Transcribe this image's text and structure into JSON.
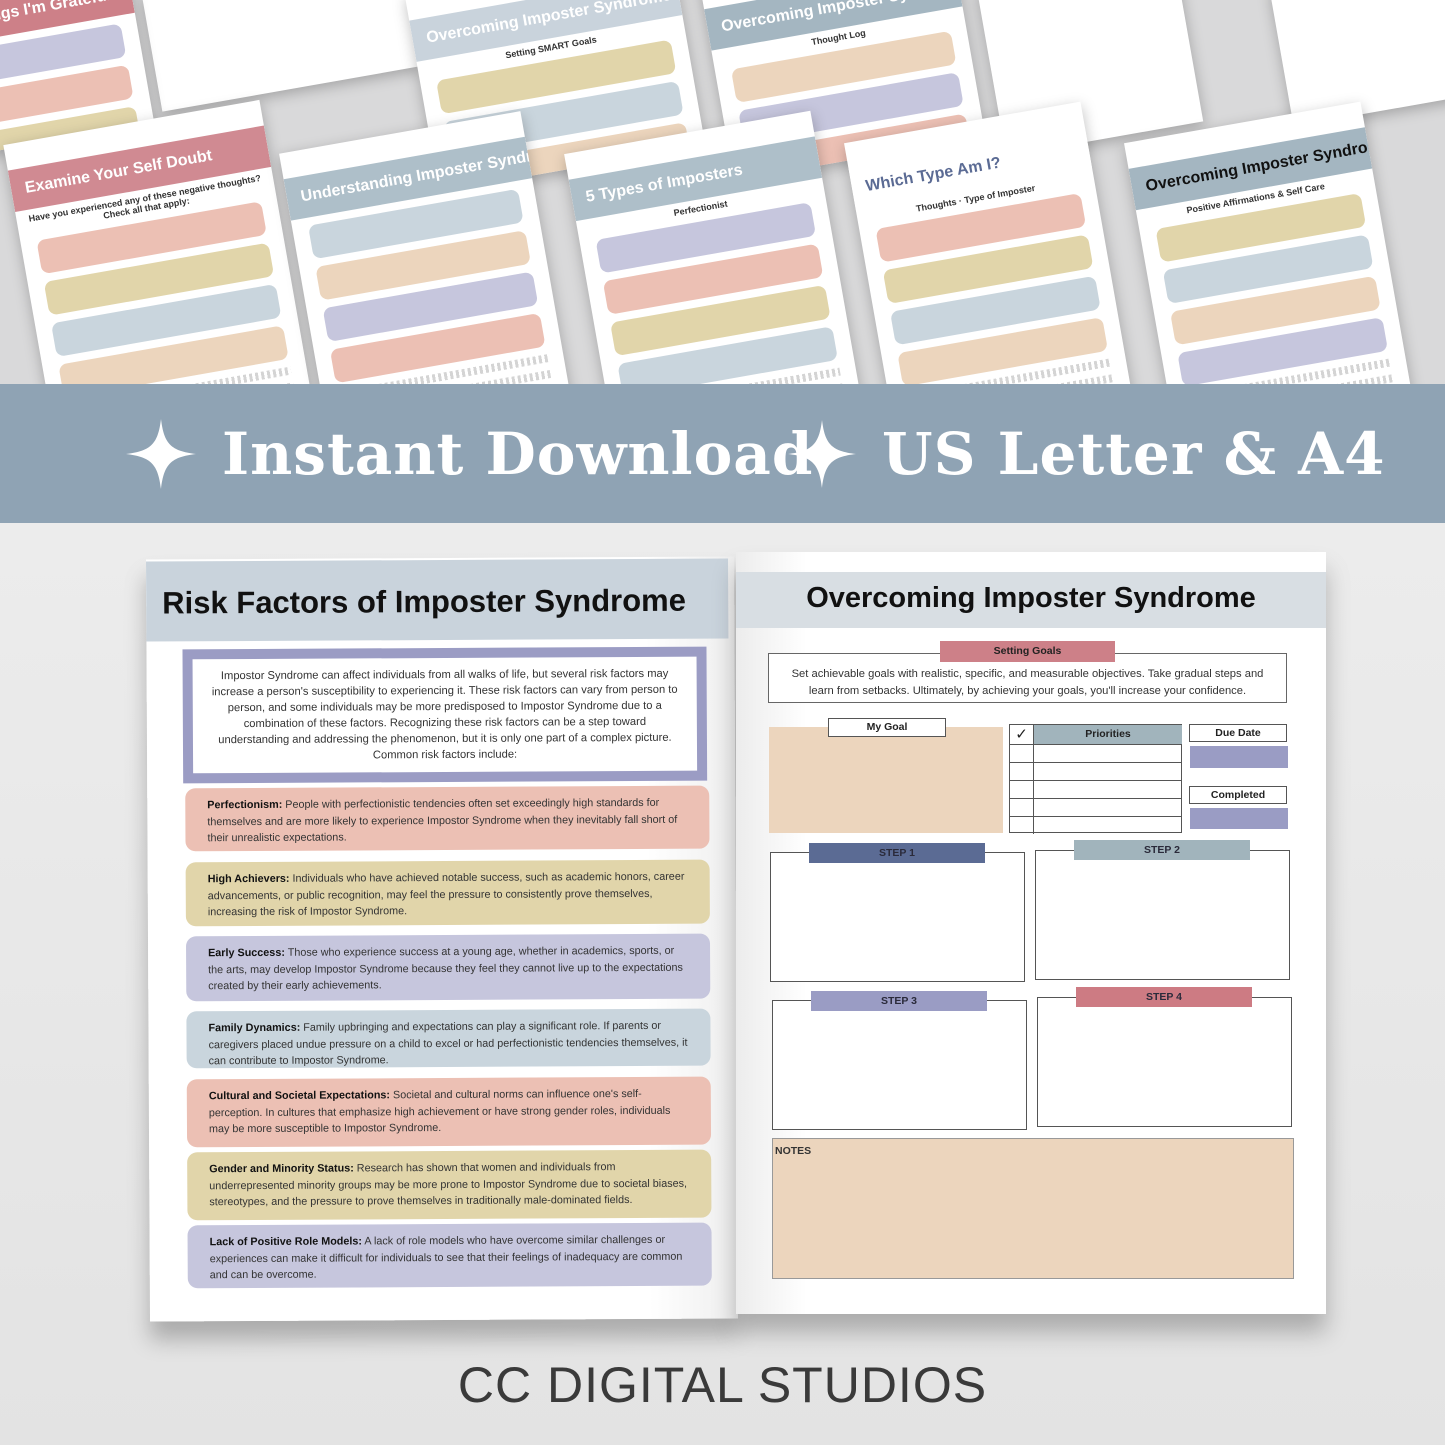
{
  "collage": {
    "thumbnails": [
      {
        "title": "Things I'm Grateful For",
        "subtitle": ""
      },
      {
        "title": "Examine Your Self Doubt",
        "subtitle": "Have you experienced any of these negative thoughts? Check all that apply:"
      },
      {
        "title": "Overcoming Imposter Syndrome",
        "subtitle": "Setting SMART Goals"
      },
      {
        "title": "Understanding Imposter Syndrome",
        "subtitle": ""
      },
      {
        "title": "Overcoming Imposter Syndrome",
        "subtitle": "Thought Log"
      },
      {
        "title": "5 Types of Imposters",
        "subtitle": "Perfectionist"
      },
      {
        "title": "Which Type Am I?",
        "subtitle": "Thoughts · Type of Imposter"
      },
      {
        "title": "Overcoming Imposter Syndrome",
        "subtitle": "Positive Affirmations & Self Care"
      }
    ]
  },
  "banner": {
    "items": [
      {
        "label": "Instant Download",
        "icon": "sparkle-icon"
      },
      {
        "label": "US Letter & A4",
        "icon": "sparkle-icon"
      }
    ],
    "color": "#8fa3b4"
  },
  "left_page": {
    "title": "Risk Factors of Imposter Syndrome",
    "intro": "Impostor Syndrome can affect individuals from all walks of life, but several risk factors may increase a person's susceptibility to experiencing it. These risk factors can vary from person to person, and some individuals may be more predisposed to Impostor Syndrome due to a combination of these factors.  Recognizing these risk factors can be a step toward understanding and addressing the phenomenon, but it is only one part of a complex picture. Common risk factors include:",
    "factors": [
      {
        "name": "Perfectionism:",
        "text": " People with perfectionistic tendencies often set exceedingly high standards for themselves and are more likely to experience Impostor Syndrome when they inevitably fall short of their unrealistic expectations.",
        "color": "#ecc0b4"
      },
      {
        "name": "High Achievers:",
        "text": " Individuals who have achieved notable success, such as academic honors, career advancements, or public recognition, may feel the pressure to consistently prove themselves, increasing the risk of Impostor Syndrome.",
        "color": "#e1d5aa"
      },
      {
        "name": "Early Success:",
        "text": " Those who experience success at a young age, whether in academics, sports, or the arts, may develop Impostor Syndrome because they feel they cannot live up to the expectations created by their early achievements.",
        "color": "#c6c6dd"
      },
      {
        "name": "Family Dynamics:",
        "text": " Family upbringing and expectations can play a significant role. If parents or caregivers placed undue pressure on a child to excel or had perfectionistic tendencies themselves, it can contribute to Impostor Syndrome.",
        "color": "#c9d5dd"
      },
      {
        "name": "Cultural and Societal Expectations:",
        "text": " Societal and cultural norms can influence one's self-perception. In cultures that emphasize high achievement or have strong gender roles, individuals may be more susceptible to Impostor Syndrome.",
        "color": "#ecc0b4"
      },
      {
        "name": "Gender and Minority Status:",
        "text": " Research has shown that women and individuals from underrepresented minority groups may be more prone to Impostor Syndrome due to societal biases, stereotypes, and the pressure to prove themselves in traditionally male-dominated fields.",
        "color": "#e1d5aa"
      },
      {
        "name": "Lack of Positive Role Models:",
        "text": " A lack of role models who have overcome similar challenges or experiences can make it difficult for individuals to see that their feelings of inadequacy are common and can be overcome.",
        "color": "#c6c6dd"
      }
    ]
  },
  "right_page": {
    "title": "Overcoming Imposter Syndrome",
    "section_label": "Setting Goals",
    "intro": "Set achievable goals with realistic, specific, and measurable objectives. Take gradual steps and learn from setbacks.  Ultimately, by achieving your goals, you'll increase your confidence.",
    "my_goal_label": "My Goal",
    "priorities_label": "Priorities",
    "check_icon": "checkmark-icon",
    "due_date_label": "Due Date",
    "completed_label": "Completed",
    "steps": [
      {
        "label": "STEP 1",
        "color": "#5b6b94"
      },
      {
        "label": "STEP 2",
        "color": "#a1b4bc"
      },
      {
        "label": "STEP 3",
        "color": "#9a9cc4"
      },
      {
        "label": "STEP 4",
        "color": "#cd7b83"
      }
    ],
    "notes_label": "NOTES"
  },
  "footer": {
    "brand": "CC DIGITAL STUDIOS"
  }
}
